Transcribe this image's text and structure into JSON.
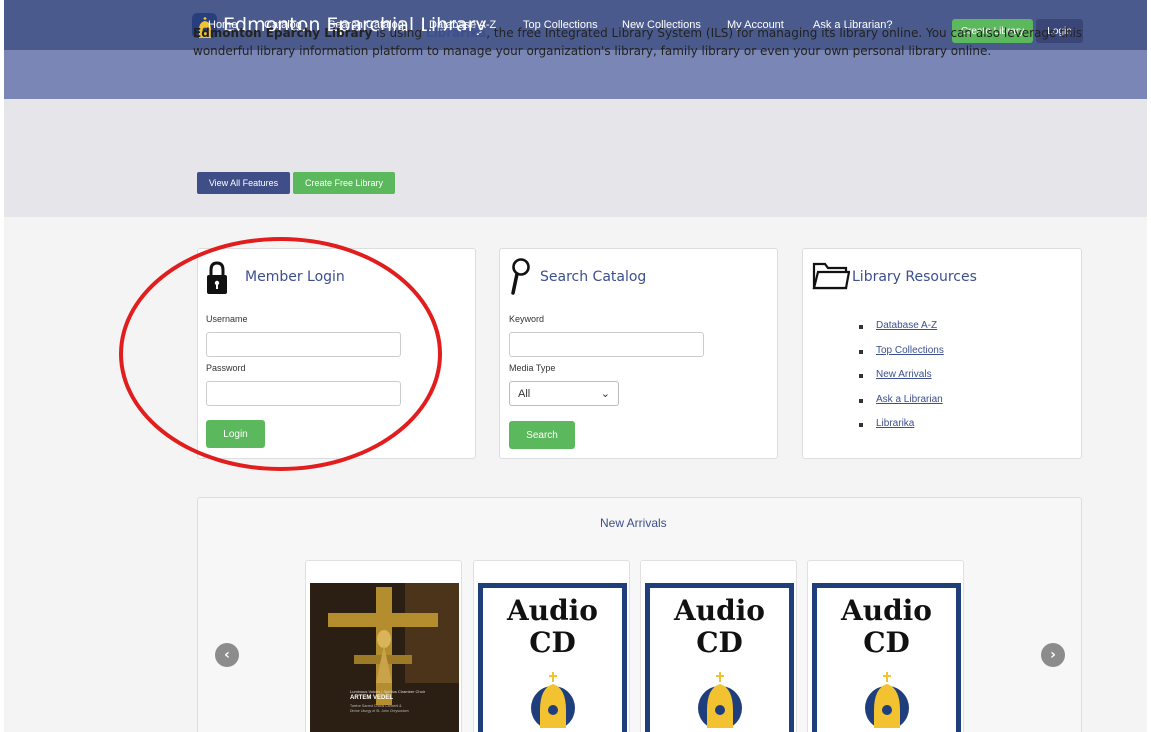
{
  "header": {
    "title": "Edmonton Eparchial Library",
    "create_library": "Create Library",
    "login": "Login"
  },
  "nav": {
    "items": [
      "Home",
      "Catalog",
      "Search Catalog",
      "Database A-Z",
      "Top Collections",
      "New Collections",
      "My Account",
      "Ask a Librarian?"
    ]
  },
  "hero": {
    "library_name": "Edmonton Eparchy Library",
    "text1": " is using ",
    "brand": "Librarika",
    "text2": ", the free Integrated Library System (ILS) for managing its library online. You can also leverage this wonderful library information platform to manage your organization's library, family library or even your own personal library online.",
    "view_features": "View All Features",
    "create_free": "Create Free Library"
  },
  "login_panel": {
    "title": "Member Login",
    "username_label": "Username",
    "password_label": "Password",
    "button": "Login"
  },
  "search_panel": {
    "title": "Search Catalog",
    "keyword_label": "Keyword",
    "media_label": "Media Type",
    "media_selected": "All",
    "button": "Search"
  },
  "resources_panel": {
    "title": "Library Resources",
    "links": [
      "Database A-Z",
      "Top Collections",
      "New Arrivals",
      "Ask a Librarian",
      "Librarika"
    ]
  },
  "arrivals": {
    "title": "New Arrivals",
    "items": [
      {
        "type": "album",
        "line1": "Luminous Voices | Spiritus Chamber Choir",
        "line2": "ARTEM VEDEL",
        "line3": "Twelve Sacred Choral Concerti & Divine Liturgy of St. John Chrysostom"
      },
      {
        "type": "cd",
        "line1": "Audio",
        "line2": "CD"
      },
      {
        "type": "cd",
        "line1": "Audio",
        "line2": "CD"
      },
      {
        "type": "cd",
        "line1": "Audio",
        "line2": "CD"
      }
    ]
  },
  "colors": {
    "header": "#4a5a8c",
    "nav": "#7a86b5",
    "green": "#5cb85c",
    "link": "#3c4f8f",
    "annotation": "#e11d1d"
  }
}
